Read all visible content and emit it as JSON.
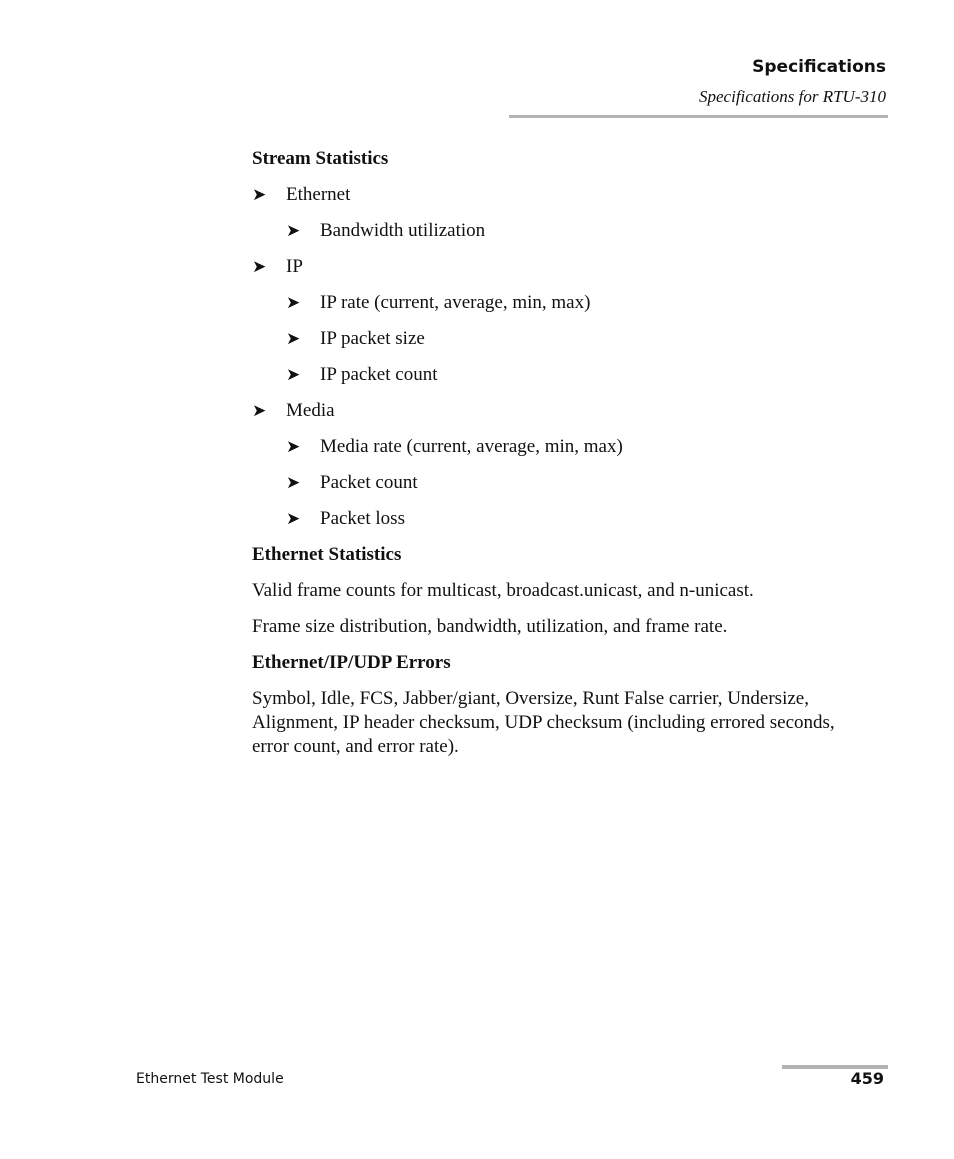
{
  "header": {
    "chapter": "Specifications",
    "section": "Specifications for RTU-310"
  },
  "sections": {
    "stream": {
      "heading": "Stream Statistics",
      "items": [
        {
          "label": "Ethernet",
          "children": [
            "Bandwidth utilization"
          ]
        },
        {
          "label": "IP",
          "children": [
            "IP rate (current, average, min, max)",
            "IP packet size",
            "IP packet count"
          ]
        },
        {
          "label": "Media",
          "children": [
            "Media rate (current, average, min, max)",
            "Packet count",
            "Packet loss"
          ]
        }
      ]
    },
    "ethernet": {
      "heading": "Ethernet Statistics",
      "paragraphs": [
        "Valid frame counts for multicast, broadcast.unicast, and n-unicast.",
        "Frame size distribution, bandwidth, utilization, and frame rate."
      ]
    },
    "errors": {
      "heading": "Ethernet/IP/UDP Errors",
      "paragraph": "Symbol, Idle, FCS, Jabber/giant, Oversize, Runt False carrier, Undersize, Alignment, IP header checksum, UDP checksum (including errored seconds, error count, and error rate)."
    }
  },
  "bullet_glyph": "➤",
  "footer": {
    "doc_title": "Ethernet Test Module",
    "page_number": "459"
  }
}
